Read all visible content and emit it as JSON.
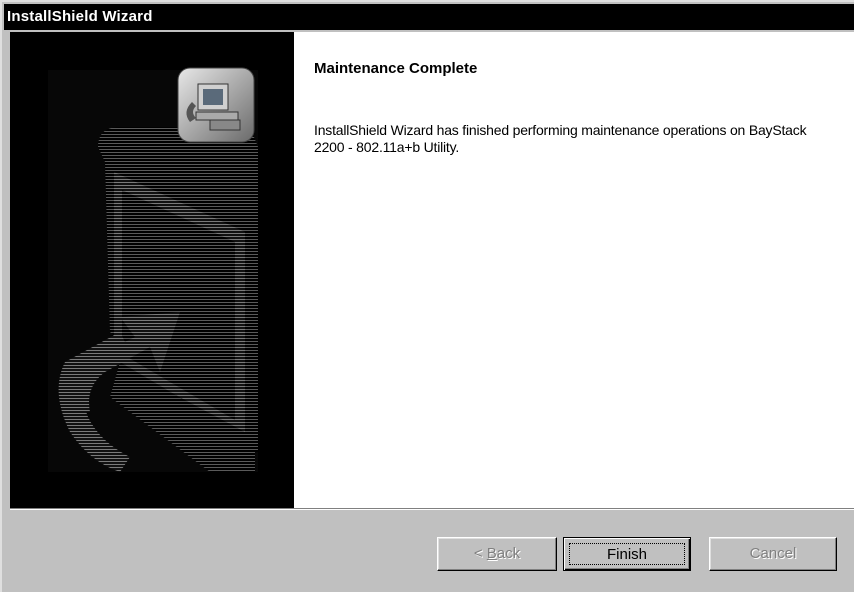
{
  "window": {
    "title": "InstallShield Wizard"
  },
  "content": {
    "heading": "Maintenance Complete",
    "message": "InstallShield Wizard has finished performing maintenance operations on BayStack 2200 - 802.11a+b Utility."
  },
  "buttons": {
    "back_prefix": "< ",
    "back_accel": "B",
    "back_rest": "ack",
    "finish": "Finish",
    "cancel": "Cancel"
  },
  "colors": {
    "title_bar": "#000000",
    "side_panel": "#000000",
    "dialog_face": "#c0c0c0",
    "disabled_text": "#808080"
  },
  "icons": {
    "side_panel_graphic": "installshield-computer-arrow-graphic",
    "side_panel_badge": "computer-setup-icon"
  }
}
